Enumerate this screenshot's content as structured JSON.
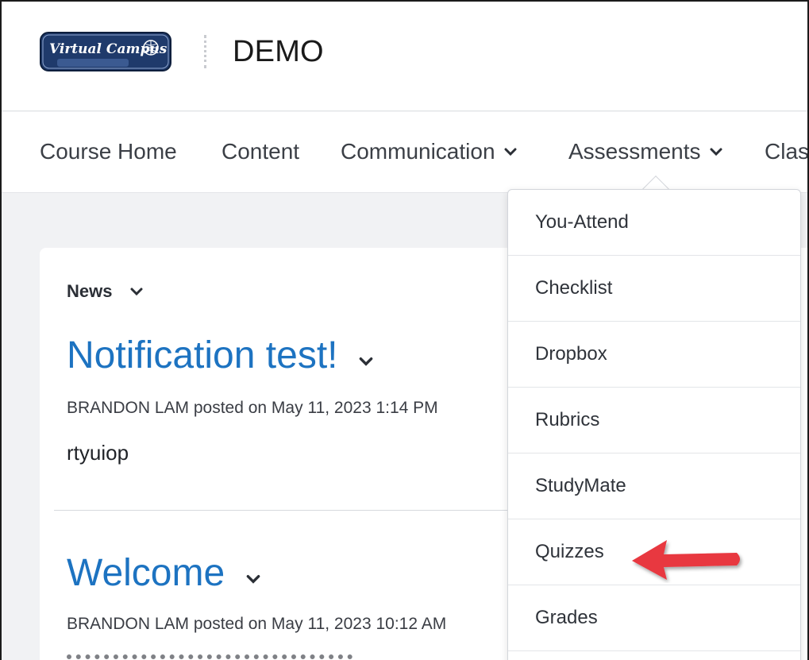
{
  "header": {
    "logo_alt": "Virtual Campus Brazosport College",
    "course_title": "DEMO"
  },
  "navbar": {
    "items": [
      {
        "label": "Course Home",
        "has_menu": false
      },
      {
        "label": "Content",
        "has_menu": false
      },
      {
        "label": "Communication",
        "has_menu": true
      },
      {
        "label": "Assessments",
        "has_menu": true
      },
      {
        "label": "Clas",
        "has_menu": false
      }
    ]
  },
  "news": {
    "label": "News",
    "items": [
      {
        "title": "Notification test!",
        "meta": "BRANDON LAM posted on May 11, 2023 1:14 PM",
        "body": "rtyuiop"
      },
      {
        "title": "Welcome",
        "meta": "BRANDON LAM posted on May 11, 2023 10:12 AM",
        "body": ""
      }
    ]
  },
  "assessments_menu": {
    "items": [
      {
        "label": "You-Attend"
      },
      {
        "label": "Checklist"
      },
      {
        "label": "Dropbox"
      },
      {
        "label": "Rubrics"
      },
      {
        "label": "StudyMate"
      },
      {
        "label": "Quizzes"
      },
      {
        "label": "Grades"
      }
    ],
    "highlighted": "Quizzes"
  },
  "colors": {
    "link_blue": "#1d73c1",
    "arrow_red": "#e8373f",
    "logo_navy": "#1f3a6b"
  }
}
